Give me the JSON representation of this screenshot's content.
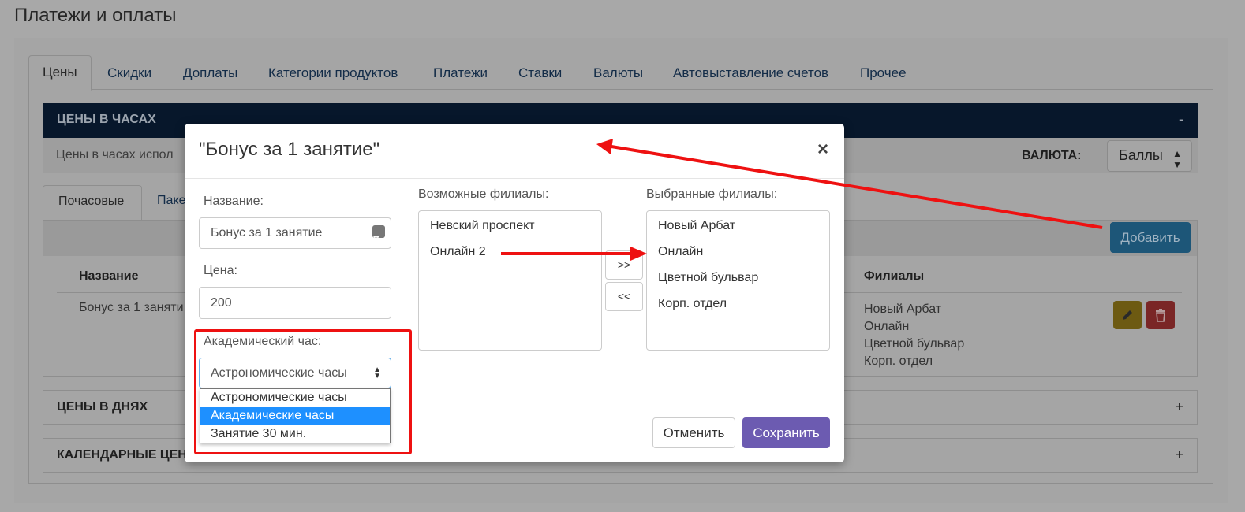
{
  "page_title": "Платежи и оплаты",
  "tabs": [
    "Цены",
    "Скидки",
    "Доплаты",
    "Категории продуктов",
    "Платежи",
    "Ставки",
    "Валюты",
    "Автовыставление счетов",
    "Прочее"
  ],
  "hours_section": {
    "title": "ЦЕНЫ В ЧАСАХ",
    "collapse": "-",
    "description": "Цены в часах испол",
    "currency_label": "ВАЛЮТА:",
    "currency_value": "Баллы",
    "subtabs": [
      "Почасовые",
      "Паке"
    ],
    "add_button": "Добавить",
    "table": {
      "col_name": "Название",
      "col_branches": "Филиалы",
      "row_name": "Бонус за 1 заняти",
      "row_branches": [
        "Новый Арбат",
        "Онлайн",
        "Цветной бульвар",
        "Корп. отдел"
      ]
    }
  },
  "sections": [
    {
      "title": "ЦЕНЫ В ДНЯХ",
      "toggle": "+"
    },
    {
      "title": "КАЛЕНДАРНЫЕ ЦЕНЫ",
      "toggle": "+"
    }
  ],
  "modal": {
    "title": "\"Бонус за 1 занятие\"",
    "close": "×",
    "name_label": "Название:",
    "name_value": "Бонус за 1 занятие",
    "price_label": "Цена:",
    "price_value": "200",
    "hour_label": "Академический час:",
    "hour_value": "Астрономические часы",
    "hour_options": [
      "Астрономические часы",
      "Академические часы",
      "Занятие 30 мин."
    ],
    "hour_highlighted": "Академические часы",
    "available_label": "Возможные филиалы:",
    "available": [
      "Невский проспект",
      "Онлайн 2"
    ],
    "selected_label": "Выбранные филиалы:",
    "selected": [
      "Новый Арбат",
      "Онлайн",
      "Цветной бульвар",
      "Корп. отдел"
    ],
    "move_right": ">>",
    "move_left": "<<",
    "cancel": "Отменить",
    "save": "Сохранить"
  },
  "colors": {
    "header_bar": "#0d2a4d",
    "save_button": "#6c5bb1",
    "annotation_red": "#ee1111",
    "highlight_option": "#1e90ff"
  }
}
